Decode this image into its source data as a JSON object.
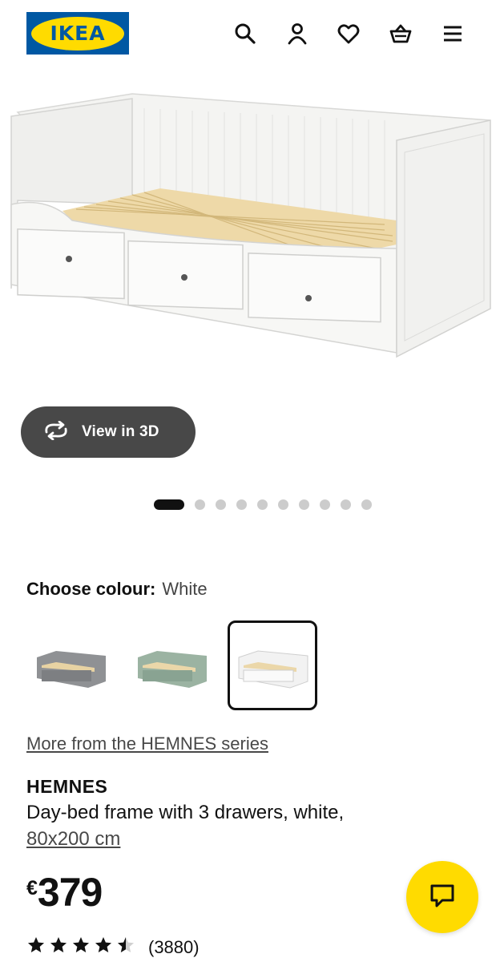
{
  "header": {
    "logo_text": "IKEA",
    "icons": [
      "search-icon",
      "user-icon",
      "heart-icon",
      "basket-icon",
      "menu-icon"
    ]
  },
  "view3d": {
    "label": "View in 3D",
    "icon": "rotate-3d-icon"
  },
  "carousel": {
    "total": 10,
    "active_index": 0
  },
  "colour": {
    "label": "Choose colour:",
    "value": "White",
    "options": [
      {
        "name": "grey",
        "color": "#8f9194",
        "selected": false
      },
      {
        "name": "green",
        "color": "#9bb3a2",
        "selected": false
      },
      {
        "name": "white",
        "color": "#f2f2f2",
        "selected": true
      }
    ]
  },
  "series_link": "More from the HEMNES series",
  "product": {
    "name": "HEMNES",
    "description": "Day-bed frame with 3 drawers, white,",
    "size": "80x200 cm"
  },
  "price": {
    "currency": "€",
    "amount": "379"
  },
  "rating": {
    "stars": 4.5,
    "max": 5,
    "review_count": "(3880)"
  },
  "chat": {
    "icon": "chat-icon"
  },
  "colors": {
    "brand_blue": "#0058a3",
    "brand_yellow": "#ffdb00",
    "button_dark": "#484848"
  }
}
